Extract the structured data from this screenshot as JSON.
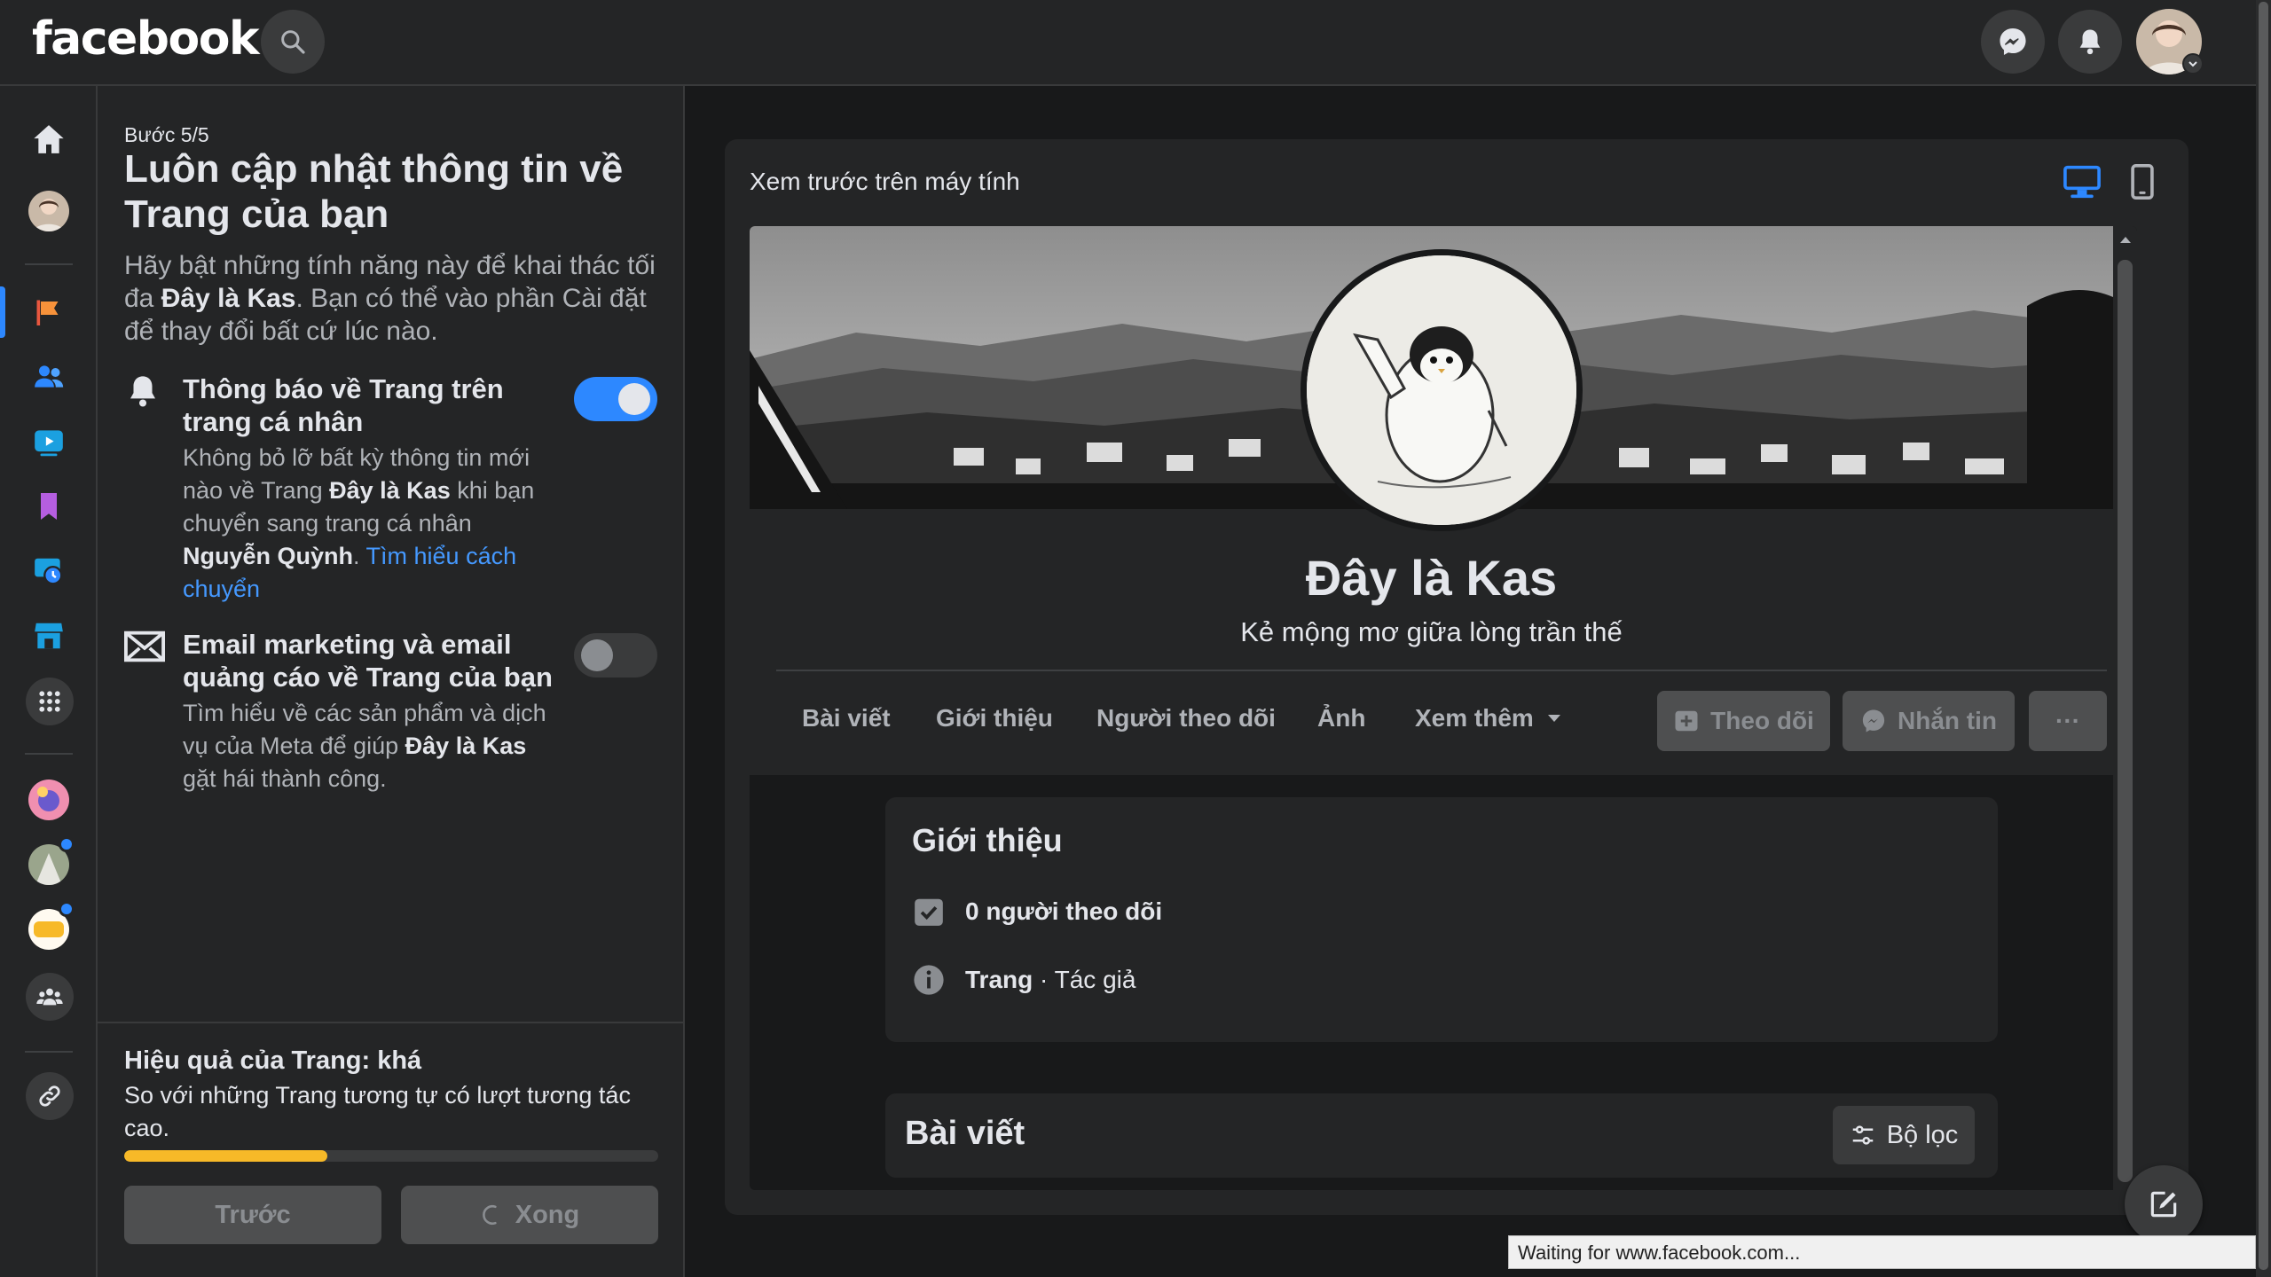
{
  "app": {
    "logo": "facebook"
  },
  "colors": {
    "accent": "#2d88ff",
    "progress": "#f7b928",
    "bg": "#18191a",
    "surface": "#242526"
  },
  "panel": {
    "step": "Bước 5/5",
    "title": "Luôn cập nhật thông tin về Trang của bạn",
    "desc_a": "Hãy bật những tính năng này để khai thác tối đa ",
    "desc_b": "Đây là Kas",
    "desc_c": ". Bạn có thể vào phần Cài đặt để thay đổi bất cứ lúc nào.",
    "options": [
      {
        "icon": "bell-icon",
        "title": "Thông báo về Trang trên trang cá nhân",
        "desc_a": "Không bỏ lỡ bất kỳ thông tin mới nào về Trang ",
        "desc_b": "Đây là Kas",
        "desc_c": " khi bạn chuyển sang trang cá nhân ",
        "desc_d": "Nguyễn Quỳnh",
        "desc_e": ". ",
        "link": "Tìm hiểu cách chuyển",
        "enabled": true
      },
      {
        "icon": "envelope-icon",
        "title": "Email marketing và email quảng cáo về Trang của bạn",
        "desc_a": "Tìm hiểu về các sản phẩm và dịch vụ của Meta để giúp ",
        "desc_b": "Đây là Kas",
        "desc_c": " gặt hái thành công.",
        "enabled": false
      }
    ],
    "performance": {
      "title": "Hiệu quả của Trang: khá",
      "desc": "So với những Trang tương tự có lượt tương tác cao.",
      "progress": 0.38
    },
    "back_label": "Trước",
    "done_label": "Xong"
  },
  "preview": {
    "label": "Xem trước trên máy tính",
    "page_name": "Đây là Kas",
    "page_subtitle": "Kẻ mộng mơ giữa lòng trần thế",
    "tabs": [
      "Bài viết",
      "Giới thiệu",
      "Người theo dõi",
      "Ảnh",
      "Xem thêm"
    ],
    "follow_label": "Theo dõi",
    "message_label": "Nhắn tin",
    "more_label": "···",
    "intro": {
      "title": "Giới thiệu",
      "followers": "0 người theo dõi",
      "category_bold": "Trang",
      "category_rest": " · Tác giả"
    },
    "posts": {
      "title": "Bài viết",
      "filter_label": "Bộ lọc"
    }
  },
  "status_bar": "Waiting for www.facebook.com..."
}
